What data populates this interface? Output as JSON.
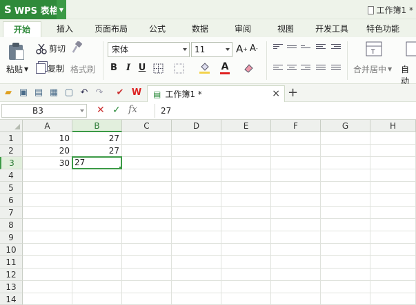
{
  "app": {
    "name": "WPS 表格",
    "logo_glyph": "S",
    "document_title": "工作簿1 *",
    "accent": "#2f8a3a"
  },
  "menu": {
    "tabs": [
      {
        "label": "开始",
        "active": true
      },
      {
        "label": "插入"
      },
      {
        "label": "页面布局"
      },
      {
        "label": "公式"
      },
      {
        "label": "数据"
      },
      {
        "label": "审阅"
      },
      {
        "label": "视图"
      },
      {
        "label": "开发工具"
      },
      {
        "label": "特色功能"
      }
    ]
  },
  "ribbon": {
    "paste_label": "粘贴",
    "cut_label": "剪切",
    "copy_label": "复制",
    "format_painter_label": "格式刷",
    "font_name": "宋体",
    "font_size": "11",
    "bold": "B",
    "italic": "I",
    "underline": "U",
    "font_color_glyph": "A",
    "merge_center_label": "合并居中",
    "autowrap_label": "自动"
  },
  "doc_tabs": {
    "active_label": "工作簿1 *",
    "close_glyph": "×",
    "new_tab_glyph": "+"
  },
  "formula_bar": {
    "name_box": "B3",
    "cancel_glyph": "✕",
    "confirm_glyph": "✓",
    "fx_label": "fx",
    "content": "27"
  },
  "sheet": {
    "columns": [
      "A",
      "B",
      "C",
      "D",
      "E",
      "F",
      "G",
      "H"
    ],
    "rows": [
      "1",
      "2",
      "3",
      "4",
      "5",
      "6",
      "7",
      "8",
      "9",
      "10",
      "11",
      "12",
      "13",
      "14"
    ],
    "cells": {
      "A1": "10",
      "B1": "27",
      "A2": "20",
      "B2": "27",
      "A3": "30",
      "B3": "27"
    },
    "selected_column": "B",
    "selected_row": "3"
  }
}
